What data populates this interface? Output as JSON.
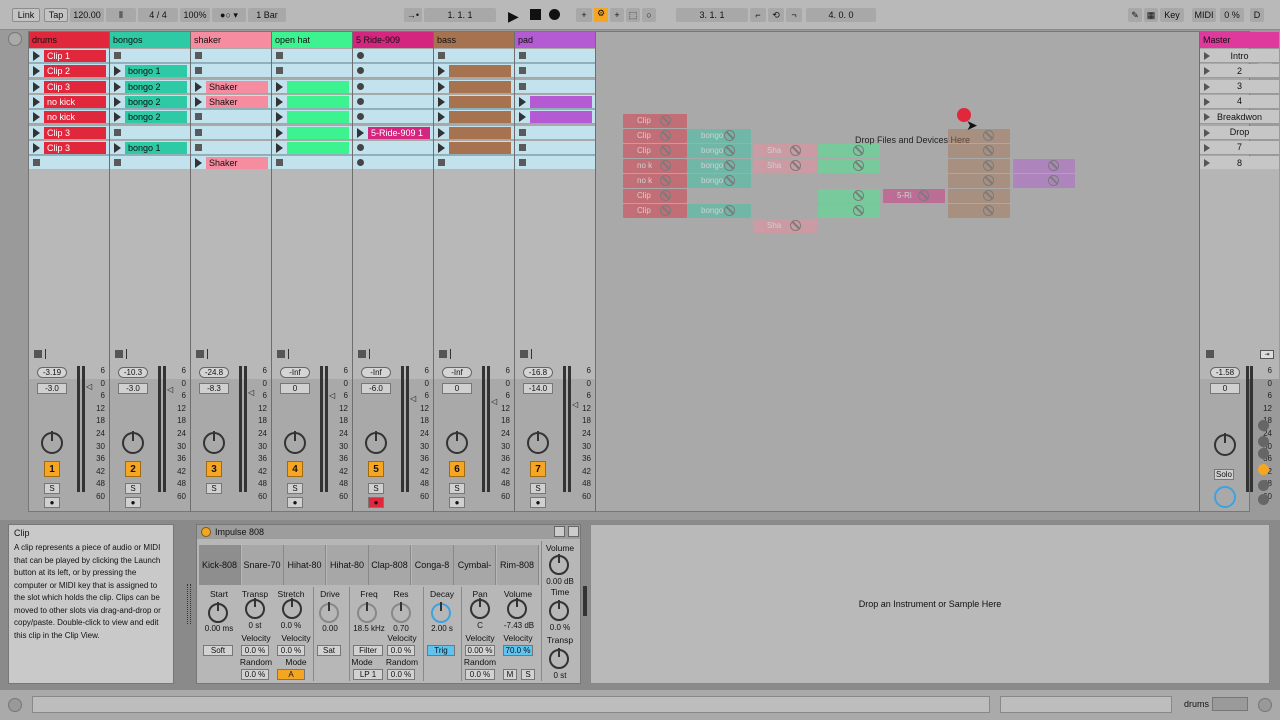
{
  "toolbar": {
    "link": "Link",
    "tap": "Tap",
    "tempo": "120.00",
    "signature": "4 / 4",
    "zoom": "100%",
    "quantize": "1 Bar",
    "position": "1.   1.   1",
    "loop_start": "3.   1.   1",
    "loop_length": "4.   0.   0",
    "key": "Key",
    "midi": "MIDI",
    "cpu": "0 %",
    "d": "D"
  },
  "tracks": [
    {
      "name": "drums",
      "color": "#e0273b",
      "clip_color": "#e0273b",
      "vol": "-3.19",
      "pan": "-3.0",
      "num": "1",
      "clips": [
        "Clip 1",
        "Clip 2",
        "Clip 3",
        "no kick",
        "no kick",
        "Clip 3",
        "Clip 3",
        ""
      ]
    },
    {
      "name": "bongos",
      "color": "#2ec9a5",
      "clip_color": "#2ec9a5",
      "vol": "-10.3",
      "pan": "-3.0",
      "num": "2",
      "clips": [
        "",
        "bongo 1",
        "bongo 2",
        "bongo 2",
        "bongo 2",
        "",
        "bongo 1",
        ""
      ]
    },
    {
      "name": "shaker",
      "color": "#f58ca0",
      "clip_color": "#f58ca0",
      "vol": "-24.8",
      "pan": "-8.3",
      "num": "3",
      "clips": [
        "",
        "",
        "Shaker",
        "Shaker",
        "",
        "",
        "",
        "Shaker"
      ]
    },
    {
      "name": "open hat",
      "color": "#3df38f",
      "clip_color": "#3df38f",
      "vol": "-Inf",
      "pan": "0",
      "num": "4",
      "clips": [
        "",
        "",
        "",
        "",
        "",
        "",
        "",
        ""
      ]
    },
    {
      "name": "5 Ride-909",
      "color": "#d4267f",
      "clip_color": "#d4267f",
      "vol": "-Inf",
      "pan": "-6.0",
      "num": "5",
      "clips": [
        "",
        "",
        "",
        "",
        "",
        "5-Ride-909 1",
        "",
        ""
      ]
    },
    {
      "name": "bass",
      "color": "#a67250",
      "clip_color": "#a67250",
      "vol": "-Inf",
      "pan": "0",
      "num": "6",
      "clips": [
        "",
        "",
        "",
        "",
        "",
        "",
        "",
        ""
      ]
    },
    {
      "name": "pad",
      "color": "#b45ad3",
      "clip_color": "#b45ad3",
      "vol": "-16.8",
      "pan": "-14.0",
      "num": "7",
      "clips": [
        "",
        "",
        "",
        "",
        "",
        "",
        "",
        ""
      ]
    }
  ],
  "master": {
    "name": "Master",
    "color": "#e0399e",
    "vol": "-1.58",
    "pan": "0",
    "solo": "Solo",
    "scenes": [
      "Intro",
      "2",
      "3",
      "4",
      "Breakdwon",
      "Drop",
      "7",
      "8"
    ]
  },
  "scale": [
    "6",
    "0",
    "6",
    "12",
    "18",
    "24",
    "30",
    "36",
    "42",
    "48",
    "60"
  ],
  "dropzone": {
    "text": "Drop Files and Devices Here"
  },
  "info": {
    "title": "Clip",
    "text": "A clip represents a piece of audio or MIDI that can be played by clicking the Launch button at its left, or by pressing the computer or MIDI key that is assigned to the slot which holds the clip. Clips can be moved to other slots via drag-and-drop or copy/paste. Double-click to view and edit this clip in the Clip View."
  },
  "device": {
    "name": "Impulse 808",
    "pads": [
      "Kick-808",
      "Snare-70",
      "Hihat-80",
      "Hihat-80",
      "Clap-808",
      "Conga-8",
      "Cymbal-",
      "Rim-808"
    ],
    "start": "Start",
    "start_val": "0.00 ms",
    "transp": "Transp",
    "transp_val": "0 st",
    "stretch": "Stretch",
    "stretch_val": "0.0 %",
    "drive": "Drive",
    "drive_val": "0.00",
    "freq": "Freq",
    "freq_val": "18.5 kHz",
    "res": "Res",
    "res_val": "0.70",
    "decay": "Decay",
    "decay_val": "2.00 s",
    "pan": "Pan",
    "pan_val": "C",
    "volume": "Volume",
    "volume_val": "-7.43 dB",
    "velocity": "Velocity",
    "random": "Random",
    "mode": "Mode",
    "soft": "Soft",
    "sat": "Sat",
    "filter": "Filter",
    "trig": "Trig",
    "v1": "0.0 %",
    "v2": "0.0 %",
    "v3": "0.0 %",
    "v4": "0.00 %",
    "v5": "70.0 %",
    "r1": "0.0 %",
    "r2": "0.0 %",
    "r3": "0.0 %",
    "mode_a": "A",
    "mode_lp": "LP 1",
    "m": "M",
    "s": "S",
    "right_volume": "Volume",
    "right_volume_val": "0.00 dB",
    "time": "Time",
    "time_val": "0.0 %",
    "transp2": "Transp",
    "transp2_val": "0 st"
  },
  "instrument_drop": "Drop an Instrument or Sample Here",
  "status": {
    "track": "drums"
  }
}
